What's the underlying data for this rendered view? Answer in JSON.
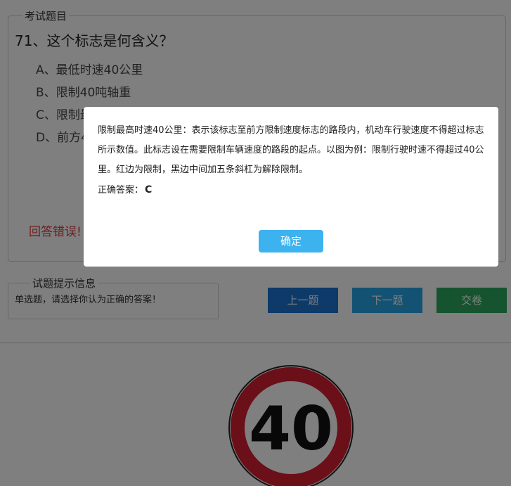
{
  "question_section": {
    "legend": "考试题目",
    "title": "71、这个标志是何含义？",
    "options": [
      "A、最低时速40公里",
      "B、限制40吨轴重",
      "C、限制最高时速40公里",
      "D、前方40米减速"
    ],
    "feedback": "回答错误!"
  },
  "hint_section": {
    "legend": "试题提示信息",
    "text": "单选题，请选择你认为正确的答案！"
  },
  "buttons": {
    "prev": "上一题",
    "next": "下一题",
    "submit": "交卷"
  },
  "sign": {
    "number": "40",
    "ring_color": "#d71f32"
  },
  "modal": {
    "explanation": "限制最高时速40公里：表示该标志至前方限制速度标志的路段内，机动车行驶速度不得超过标志所示数值。此标志设在需要限制车辆速度的路段的起点。以图为例：限制行驶时速不得超过40公里。红边为限制，黑边中间加五条斜杠为解除限制。",
    "answer_label": "正确答案：",
    "answer_value": "C",
    "ok_label": "确定"
  }
}
